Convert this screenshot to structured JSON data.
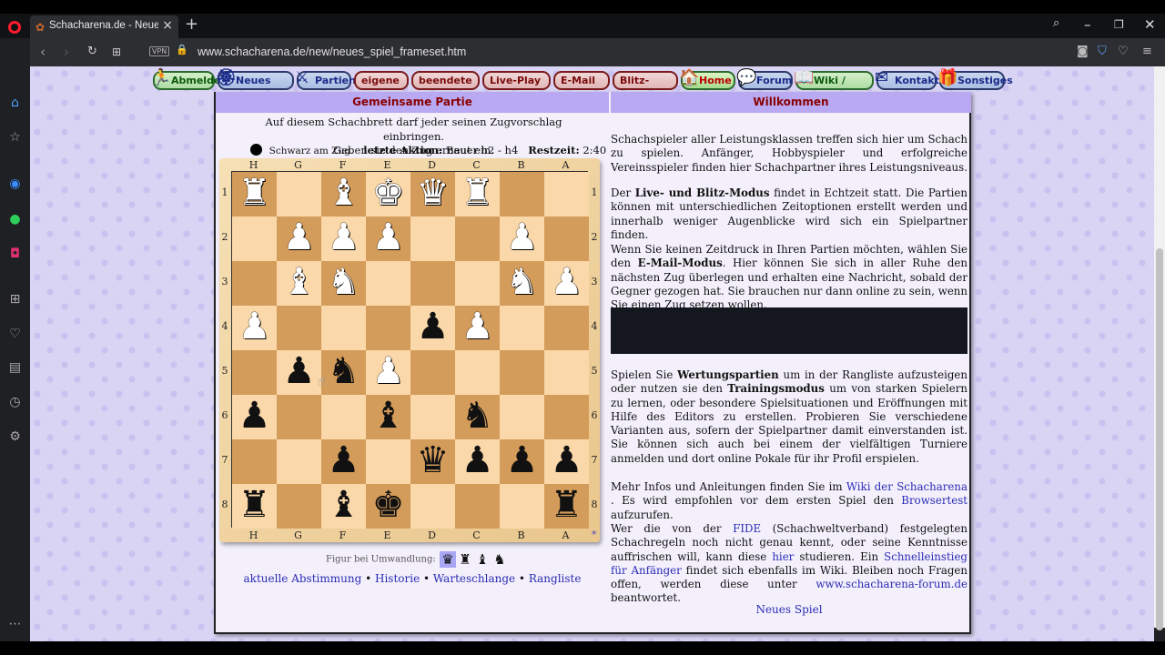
{
  "browser": {
    "tab_title": "Schacharena.de - Neues Sp",
    "url": "www.schacharena.de/new/neues_spiel_frameset.htm",
    "vpn_label": "VPN"
  },
  "menu": [
    {
      "label": "Abmelden",
      "icon": "🏃",
      "style": "green",
      "w": 68
    },
    {
      "label": "Neues Spiel",
      "icon": "🏵",
      "style": "blue",
      "w": 84
    },
    {
      "label": "Partien",
      "icon": "⚔",
      "style": "blue",
      "w": 60
    },
    {
      "label": "eigene P.",
      "icon": "",
      "style": "plain",
      "w": 60
    },
    {
      "label": "beendete P.",
      "icon": "",
      "style": "plain",
      "w": 75
    },
    {
      "label": "Live-Play P.",
      "icon": "",
      "style": "plain",
      "w": 75
    },
    {
      "label": "E-Mail P.",
      "icon": "",
      "style": "plain",
      "w": 62
    },
    {
      "label": "Blitz-Modus",
      "icon": "",
      "style": "plain",
      "w": 72
    },
    {
      "label": "Home",
      "icon": "🏠",
      "style": "home",
      "w": 60
    },
    {
      "label": "Forum",
      "icon": "💬",
      "style": "blue",
      "w": 60
    },
    {
      "label": "Wiki / Hilfe",
      "icon": "📖",
      "style": "green",
      "w": 86
    },
    {
      "label": "Kontakt",
      "icon": "✉",
      "style": "blue",
      "w": 66
    },
    {
      "label": "Sonstiges",
      "icon": "🎁",
      "style": "blue",
      "w": 72
    }
  ],
  "left_panel": {
    "header": "Gemeinsame Partie",
    "intro_line1": "Auf diesem Schachbrett darf jeder seinen Zugvorschlag einbringen.",
    "intro_line2": "Geben sie den Zug erneut ein.",
    "turn_text": "Schwarz am Zug.",
    "last_action_label": "letzte Aktion:",
    "last_action_value": "Bauer h2 - h4",
    "remaining_label": "Restzeit:",
    "remaining_value": "2:40",
    "files": [
      "H",
      "G",
      "F",
      "E",
      "D",
      "C",
      "B",
      "A"
    ],
    "ranks": [
      "1",
      "2",
      "3",
      "4",
      "5",
      "6",
      "7",
      "8"
    ],
    "pieces": [
      [
        "wR",
        "",
        "wB",
        "wK",
        "wQ",
        "wR",
        "",
        ""
      ],
      [
        "",
        "wP",
        "wP",
        "wP",
        "",
        "",
        "wP",
        ""
      ],
      [
        "",
        "wB",
        "wN",
        "",
        "",
        "",
        "wN",
        "wP"
      ],
      [
        "wP",
        "",
        "",
        "",
        "bP",
        "wP",
        "",
        ""
      ],
      [
        "",
        "bP",
        "bN",
        "wP",
        "",
        "",
        "",
        ""
      ],
      [
        "bP",
        "",
        "",
        "bB",
        "",
        "bN",
        "",
        ""
      ],
      [
        "",
        "",
        "bP",
        "",
        "bQ",
        "bP",
        "bP",
        "bP"
      ],
      [
        "bR",
        "",
        "bB",
        "bK",
        "",
        "",
        "",
        "bR"
      ]
    ],
    "promotion_label": "Figur bei Umwandlung:",
    "promotion_pieces": [
      "♛",
      "♜",
      "♝",
      "♞"
    ],
    "links": [
      "aktuelle Abstimmung",
      "Historie",
      "Warteschlange",
      "Rangliste"
    ],
    "star": "*"
  },
  "right_panel": {
    "header": "Willkommen",
    "p1": "Schachspieler aller Leistungsklassen treffen sich hier um Schach zu spielen. Anfänger, Hobbyspieler und erfolgreiche Vereinsspieler finden hier Schachpartner ihres Leistungsniveaus.",
    "p2_pre": "Der ",
    "p2_bold": "Live- und Blitz-Modus",
    "p2_post": " findet in Echtzeit statt. Die Partien können mit unterschiedlichen Zeitoptionen erstellt werden und innerhalb weniger Augenblicke wird sich ein Spielpartner finden.",
    "p3_pre": "Wenn Sie keinen Zeitdruck in Ihren Partien möchten, wählen Sie den ",
    "p3_bold": "E-Mail-Modus",
    "p3_post": ". Hier können Sie sich in aller Ruhe den nächsten Zug überlegen und erhalten eine Nachricht, sobald der Gegner gezogen hat. Sie brauchen nur dann online zu sein, wenn Sie einen Zug setzen wollen.",
    "p4_pre": "Spielen Sie ",
    "p4_bold1": "Wertungspartien",
    "p4_mid": " um in der Rangliste aufzusteigen oder nutzen sie den ",
    "p4_bold2": "Trainingsmodus",
    "p4_post": " um von starken Spielern zu lernen, oder besondere Spielsituationen und Eröffnungen mit Hilfe des Editors zu erstellen. Probieren Sie verschiedene Varianten aus, sofern der Spielpartner damit einverstanden ist. Sie können sich auch bei einem der vielfältigen Turniere anmelden und dort online Pokale für ihr Profil erspielen.",
    "p5_pre": "Mehr Infos und Anleitungen finden Sie im ",
    "p5_link1": "Wiki der Schacharena",
    "p5_mid": " . Es wird empfohlen vor dem ersten Spiel den ",
    "p5_link2": "Browsertest",
    "p5_post": " aufzurufen.",
    "p6_pre": "Wer die von der ",
    "p6_link1": "FIDE",
    "p6_mid1": " (Schachweltverband) festgelegten Schachregeln noch nicht genau kennt, oder seine Kenntnisse auffrischen will, kann diese ",
    "p6_link2": "hier",
    "p6_mid2": " studieren. Ein ",
    "p6_link3": "Schnelleinstieg für Anfänger",
    "p6_mid3": " findet sich ebenfalls im Wiki. Bleiben noch Fragen offen, werden diese unter ",
    "p6_link4": "www.schacharena-forum.de",
    "p6_post": " beantwortet.",
    "new_game": "Neues Spiel"
  }
}
